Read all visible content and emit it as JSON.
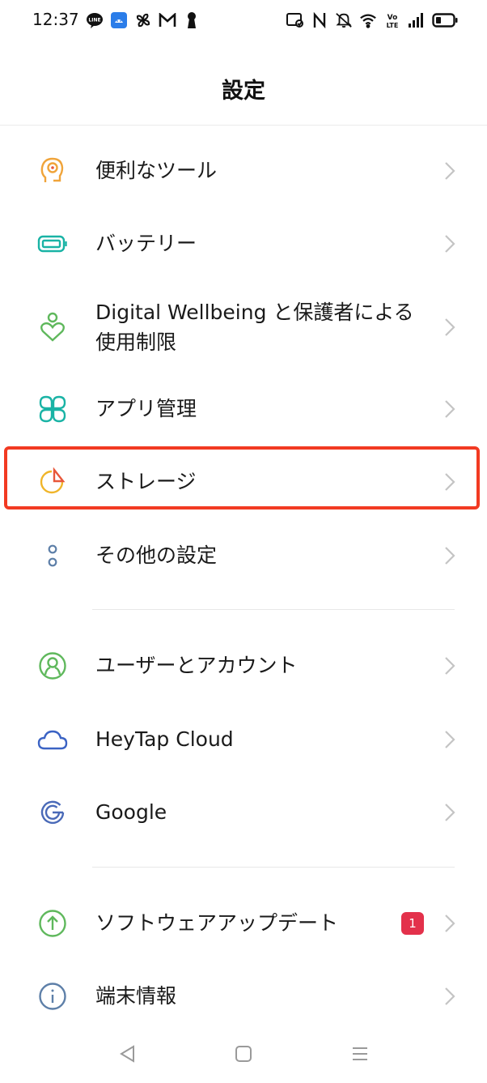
{
  "status_bar": {
    "time": "12:37",
    "left_icons": [
      "line-icon",
      "android-icon",
      "pinwheel-icon",
      "gmail-icon",
      "keyhole-icon"
    ],
    "right_icons": [
      "nfc-card-icon",
      "nfc-icon",
      "mute-icon",
      "wifi-icon",
      "volte-icon",
      "signal-icon",
      "battery-icon"
    ]
  },
  "header": {
    "title": "設定"
  },
  "items": [
    {
      "label": "便利なツール",
      "icon": "tools-icon"
    },
    {
      "label": "バッテリー",
      "icon": "battery-icon"
    },
    {
      "label": "Digital Wellbeing と保護者による使用制限",
      "icon": "wellbeing-icon"
    },
    {
      "label": "アプリ管理",
      "icon": "app-management-icon"
    },
    {
      "label": "ストレージ",
      "icon": "storage-icon"
    },
    {
      "label": "その他の設定",
      "icon": "more-settings-icon"
    },
    {
      "label": "ユーザーとアカウント",
      "icon": "user-account-icon"
    },
    {
      "label": "HeyTap Cloud",
      "icon": "cloud-icon"
    },
    {
      "label": "Google",
      "icon": "google-icon"
    },
    {
      "label": "ソフトウェアアップデート",
      "icon": "software-update-icon",
      "badge": "1"
    },
    {
      "label": "端末情報",
      "icon": "info-icon"
    }
  ],
  "colors": {
    "highlight": "#f23a22",
    "badge": "#e3314b",
    "chevron": "#c4c4c4"
  },
  "navbar": [
    "back-icon",
    "home-icon",
    "menu-icon"
  ]
}
